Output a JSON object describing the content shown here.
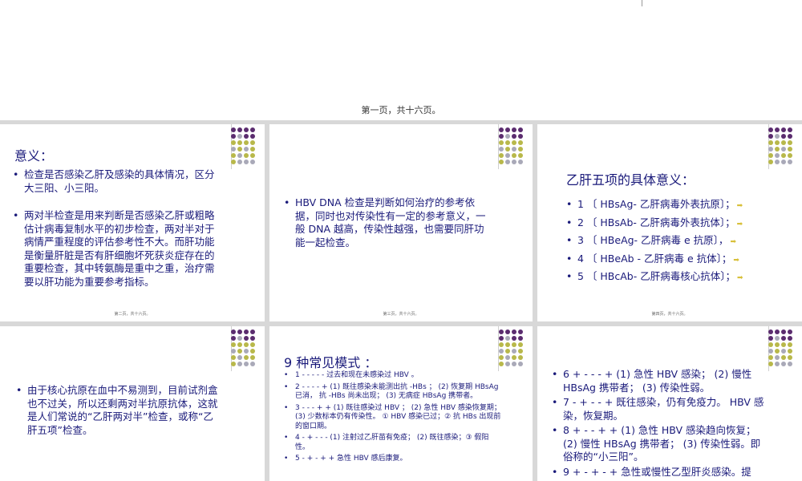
{
  "top": {
    "caption": "第一页，共十六页。"
  },
  "slides": {
    "s1": {
      "title": "意义：",
      "bullets": [
        "检查是否感染乙肝及感染的具体情况，区分大三阳、小三阳。",
        "两对半检查是用来判断是否感染乙肝或粗略估计病毒复制水平的初步检查，两对半对于病情严重程度的评估参考性不大。而肝功能是衡量肝脏是否有肝细胞坏死获炎症存在的重要检查，其中转氨酶是重中之重，治疗需要以肝功能为重要参考指标。"
      ],
      "footer": "第二页，共十六页。"
    },
    "s2": {
      "bullets": [
        "HBV DNA 检查是判断如何治疗的参考依据，同时也对传染性有一定的参考意义，一般 DNA 越高，传染性越强，也需要同肝功能一起检查。"
      ],
      "footer": "第三页，共十六页。"
    },
    "s3": {
      "title": "乙肝五项的具体意义：",
      "bullets": [
        "1 〔 HBsAg- 乙肝病毒外表抗原〕；",
        "2 〔 HBsAb- 乙肝病毒外表抗体〕；",
        "3 〔 HBeAg- 乙肝病毒 e 抗原〕，",
        "4 〔 HBeAb - 乙肝病毒 e 抗体〕；",
        "5 〔 HBcAb- 乙肝病毒核心抗体〕；"
      ],
      "footer": "第四页，共十六页。"
    },
    "s4": {
      "bullets": [
        "由于核心抗原在血中不易测到，目前试剂盒也不过关，所以还剩两对半抗原抗体，这就是人们常说的“乙肝两对半”检查，或称“乙肝五项”检查。"
      ]
    },
    "s5": {
      "title": "9 种常见模式 ：",
      "bullets": [
        "1 - - - - -  过去和现在未感染过 HBV 。",
        "2 - - - - + (1) 既往感染未能测出抗 -HBs ； (2) 恢复期 HBsAg 已消，  抗 -HBs 尚未出现； (3) 无病症 HBsAg 携带者。",
        "3 - - - + + (1) 既往感染过 HBV ； (2) 急性 HBV 感染恢复期；  (3) 少数标本仍有传染性。 ① HBV 感染已过；② 抗 HBs 出现前的窗口期。",
        "4 - + - - - (1) 注射过乙肝苗有免疫； (2) 既往感染；③ 假阳性。",
        "5 - + - + +  急性 HBV 感后康复。"
      ]
    },
    "s6": {
      "bullets": [
        "6 + - - - + (1) 急性 HBV 感染； (2) 慢性 HBsAg 携带者； (3) 传染性弱。",
        "7 - + - - +  既往感染，仍有免疫力。 HBV 感染，恢复期。",
        "8 + - - + + (1) 急性 HBV 感染趋向恢复； (2) 慢性 HBsAg 携带者；  (3) 传染性弱。即俗称的“小三阳”。",
        "9 + - + - +  急性或慢性乙型肝炎感染。提"
      ]
    }
  },
  "colors": {
    "text": "#1a1a7a",
    "purple": "#5b2c6f",
    "olive": "#b8b84a",
    "gray": "#a9a9b8"
  }
}
